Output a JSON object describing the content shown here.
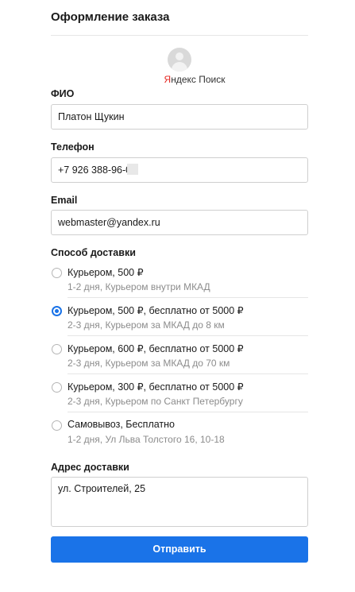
{
  "header": {
    "title": "Оформление заказа"
  },
  "brand": {
    "letter": "Я",
    "rest": "ндекс Поиск"
  },
  "fio": {
    "label": "ФИО",
    "value": "Платон Щукин"
  },
  "phone": {
    "label": "Телефон",
    "value": "+7 926 388-96-0"
  },
  "email": {
    "label": "Email",
    "value": "webmaster@yandex.ru"
  },
  "delivery": {
    "label": "Способ доставки",
    "options": [
      {
        "title": "Курьером, 500 ₽",
        "sub": "1-2 дня, Курьером внутри МКАД",
        "selected": false
      },
      {
        "title": "Курьером, 500 ₽, бесплатно от 5000 ₽",
        "sub": "2-3 дня, Курьером за МКАД до 8 км",
        "selected": true
      },
      {
        "title": "Курьером, 600 ₽, бесплатно от 5000 ₽",
        "sub": "2-3 дня, Курьером за МКАД до 70 км",
        "selected": false
      },
      {
        "title": "Курьером, 300 ₽, бесплатно от 5000 ₽",
        "sub": "2-3 дня, Курьером по Санкт Петербургу",
        "selected": false
      },
      {
        "title": "Самовывоз, Бесплатно",
        "sub": "1-2 дня, Ул Льва Толстого 16, 10-18",
        "selected": false
      }
    ]
  },
  "address": {
    "label": "Адрес доставки",
    "value": "ул. Строителей, 25"
  },
  "submit": {
    "label": "Отправить"
  },
  "colors": {
    "accent": "#1a73e8",
    "brand_red": "#e52620"
  }
}
